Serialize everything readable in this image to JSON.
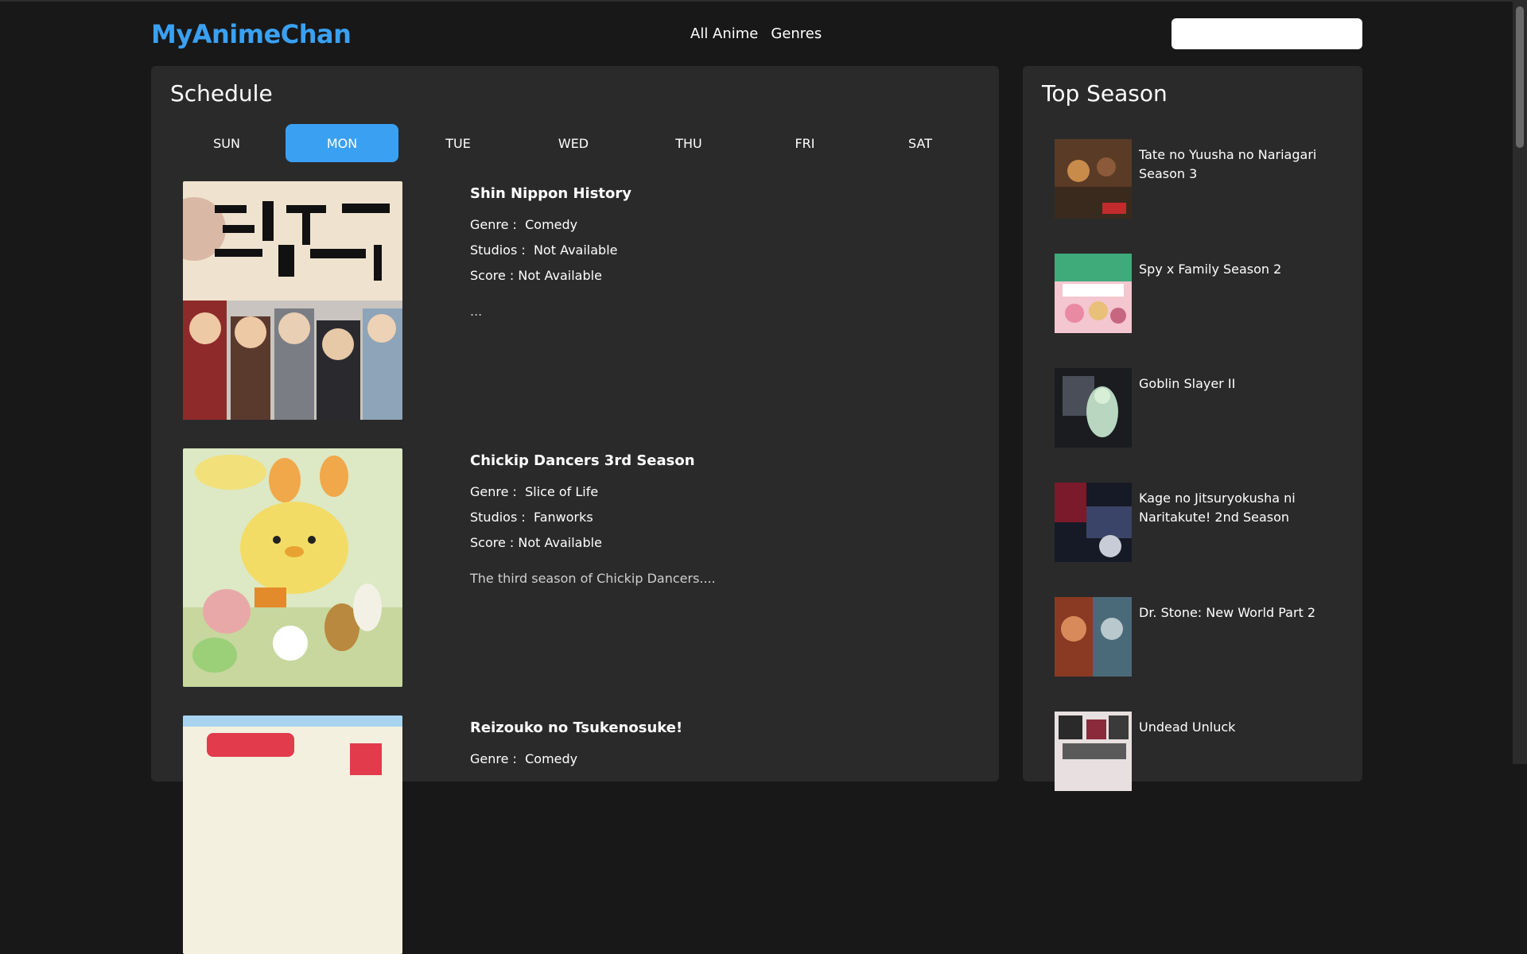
{
  "app": {
    "title": "MyAnimeChan"
  },
  "nav": {
    "all_anime": "All Anime",
    "genres": "Genres"
  },
  "search": {
    "placeholder": "",
    "value": ""
  },
  "schedule": {
    "title": "Schedule",
    "days": [
      "SUN",
      "MON",
      "TUE",
      "WED",
      "THU",
      "FRI",
      "SAT"
    ],
    "active_day": "MON",
    "items": [
      {
        "title": "Shin Nippon History",
        "genre_label": "Genre :",
        "genre": "Comedy",
        "studios_label": "Studios :",
        "studios": "Not Available",
        "score_label": "Score :",
        "score": "Not Available",
        "synopsis": "..."
      },
      {
        "title": "Chickip Dancers 3rd Season",
        "genre_label": "Genre :",
        "genre": "Slice of Life",
        "studios_label": "Studios :",
        "studios": "Fanworks",
        "score_label": "Score :",
        "score": "Not Available",
        "synopsis": "The third season of Chickip Dancers...."
      },
      {
        "title": "Reizouko no Tsukenosuke!",
        "genre_label": "Genre :",
        "genre": "Comedy"
      }
    ]
  },
  "top_season": {
    "title": "Top Season",
    "items": [
      {
        "name": "Tate no Yuusha no Nariagari Season 3"
      },
      {
        "name": "Spy x Family Season 2"
      },
      {
        "name": "Goblin Slayer II"
      },
      {
        "name": "Kage no Jitsuryokusha ni Naritakute! 2nd Season"
      },
      {
        "name": "Dr. Stone: New World Part 2"
      },
      {
        "name": "Undead Unluck"
      }
    ]
  },
  "colors": {
    "accent": "#3aa0f2",
    "panel": "#2a2a2a",
    "background": "#181818"
  }
}
